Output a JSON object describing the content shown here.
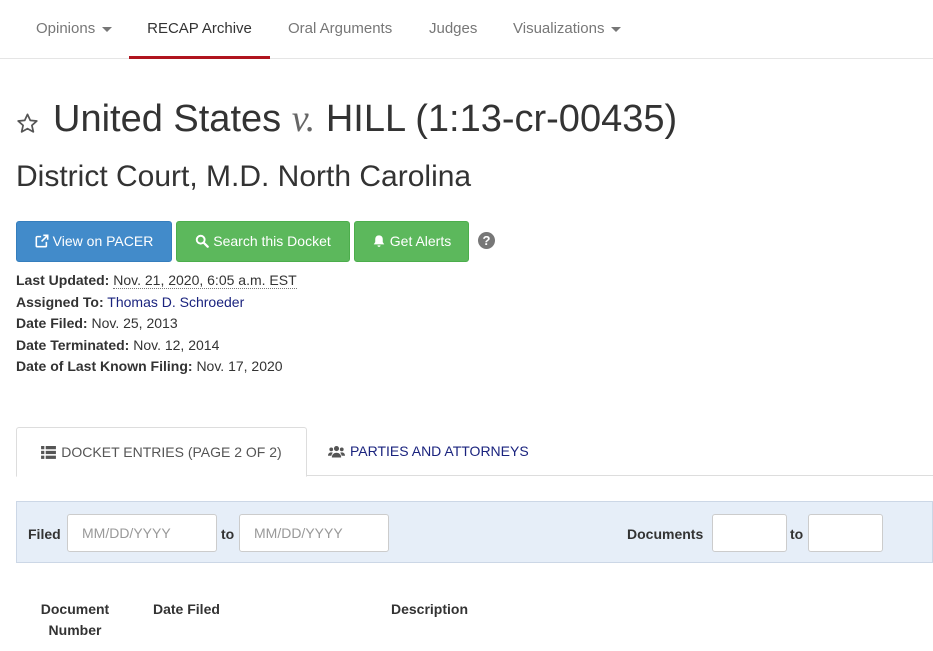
{
  "nav": {
    "items": [
      {
        "label": "Opinions",
        "dropdown": true
      },
      {
        "label": "RECAP Archive",
        "active": true
      },
      {
        "label": "Oral Arguments"
      },
      {
        "label": "Judges"
      },
      {
        "label": "Visualizations",
        "dropdown": true
      }
    ]
  },
  "case": {
    "title_party1": "United States",
    "title_v": "v.",
    "title_party2": "HILL (1:13-cr-00435)",
    "court": "District Court, M.D. North Carolina"
  },
  "buttons": {
    "view_pacer": "View on PACER",
    "search_docket": "Search this Docket",
    "get_alerts": "Get Alerts",
    "help": "?"
  },
  "meta": {
    "last_updated_label": "Last Updated:",
    "last_updated_value": "Nov. 21, 2020, 6:05 a.m. EST",
    "assigned_to_label": "Assigned To:",
    "assigned_to_value": "Thomas D. Schroeder",
    "date_filed_label": "Date Filed:",
    "date_filed_value": "Nov. 25, 2013",
    "date_terminated_label": "Date Terminated:",
    "date_terminated_value": "Nov. 12, 2014",
    "last_known_filing_label": "Date of Last Known Filing:",
    "last_known_filing_value": "Nov. 17, 2020"
  },
  "tabs": {
    "docket_entries": "DOCKET ENTRIES (PAGE 2 OF 2)",
    "parties": "PARTIES AND ATTORNEYS"
  },
  "filter": {
    "filed_label": "Filed",
    "date_from_placeholder": "MM/DD/YYYY",
    "to_label": "to",
    "date_to_placeholder": "MM/DD/YYYY",
    "documents_label": "Documents",
    "doc_to_label": "to"
  },
  "table": {
    "col_doc_number_line1": "Document",
    "col_doc_number_line2": "Number",
    "col_date_filed": "Date Filed",
    "col_description": "Description"
  },
  "colors": {
    "accent_red": "#b0141e",
    "primary_blue": "#428bca",
    "success_green": "#5cb85c",
    "link_navy": "#1a237e"
  }
}
